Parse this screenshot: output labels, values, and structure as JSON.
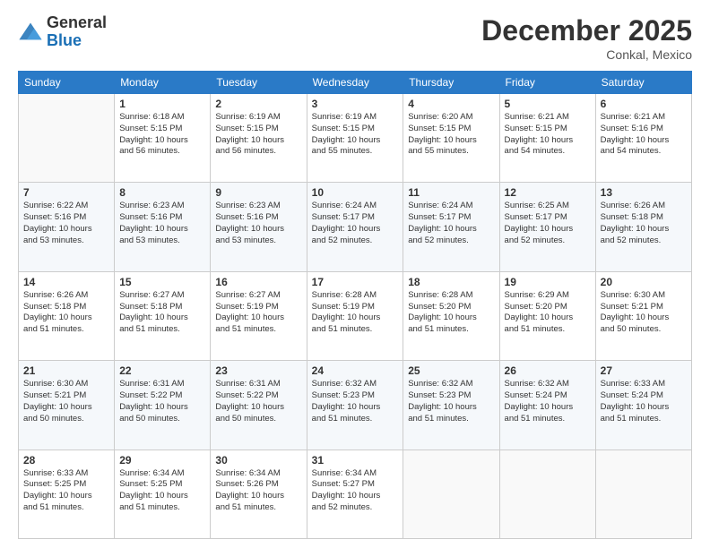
{
  "header": {
    "logo_general": "General",
    "logo_blue": "Blue",
    "month_title": "December 2025",
    "location": "Conkal, Mexico"
  },
  "days_of_week": [
    "Sunday",
    "Monday",
    "Tuesday",
    "Wednesday",
    "Thursday",
    "Friday",
    "Saturday"
  ],
  "weeks": [
    [
      {
        "day": "",
        "sunrise": "",
        "sunset": "",
        "daylight": ""
      },
      {
        "day": "1",
        "sunrise": "Sunrise: 6:18 AM",
        "sunset": "Sunset: 5:15 PM",
        "daylight": "Daylight: 10 hours and 56 minutes."
      },
      {
        "day": "2",
        "sunrise": "Sunrise: 6:19 AM",
        "sunset": "Sunset: 5:15 PM",
        "daylight": "Daylight: 10 hours and 56 minutes."
      },
      {
        "day": "3",
        "sunrise": "Sunrise: 6:19 AM",
        "sunset": "Sunset: 5:15 PM",
        "daylight": "Daylight: 10 hours and 55 minutes."
      },
      {
        "day": "4",
        "sunrise": "Sunrise: 6:20 AM",
        "sunset": "Sunset: 5:15 PM",
        "daylight": "Daylight: 10 hours and 55 minutes."
      },
      {
        "day": "5",
        "sunrise": "Sunrise: 6:21 AM",
        "sunset": "Sunset: 5:15 PM",
        "daylight": "Daylight: 10 hours and 54 minutes."
      },
      {
        "day": "6",
        "sunrise": "Sunrise: 6:21 AM",
        "sunset": "Sunset: 5:16 PM",
        "daylight": "Daylight: 10 hours and 54 minutes."
      }
    ],
    [
      {
        "day": "7",
        "sunrise": "Sunrise: 6:22 AM",
        "sunset": "Sunset: 5:16 PM",
        "daylight": "Daylight: 10 hours and 53 minutes."
      },
      {
        "day": "8",
        "sunrise": "Sunrise: 6:23 AM",
        "sunset": "Sunset: 5:16 PM",
        "daylight": "Daylight: 10 hours and 53 minutes."
      },
      {
        "day": "9",
        "sunrise": "Sunrise: 6:23 AM",
        "sunset": "Sunset: 5:16 PM",
        "daylight": "Daylight: 10 hours and 53 minutes."
      },
      {
        "day": "10",
        "sunrise": "Sunrise: 6:24 AM",
        "sunset": "Sunset: 5:17 PM",
        "daylight": "Daylight: 10 hours and 52 minutes."
      },
      {
        "day": "11",
        "sunrise": "Sunrise: 6:24 AM",
        "sunset": "Sunset: 5:17 PM",
        "daylight": "Daylight: 10 hours and 52 minutes."
      },
      {
        "day": "12",
        "sunrise": "Sunrise: 6:25 AM",
        "sunset": "Sunset: 5:17 PM",
        "daylight": "Daylight: 10 hours and 52 minutes."
      },
      {
        "day": "13",
        "sunrise": "Sunrise: 6:26 AM",
        "sunset": "Sunset: 5:18 PM",
        "daylight": "Daylight: 10 hours and 52 minutes."
      }
    ],
    [
      {
        "day": "14",
        "sunrise": "Sunrise: 6:26 AM",
        "sunset": "Sunset: 5:18 PM",
        "daylight": "Daylight: 10 hours and 51 minutes."
      },
      {
        "day": "15",
        "sunrise": "Sunrise: 6:27 AM",
        "sunset": "Sunset: 5:18 PM",
        "daylight": "Daylight: 10 hours and 51 minutes."
      },
      {
        "day": "16",
        "sunrise": "Sunrise: 6:27 AM",
        "sunset": "Sunset: 5:19 PM",
        "daylight": "Daylight: 10 hours and 51 minutes."
      },
      {
        "day": "17",
        "sunrise": "Sunrise: 6:28 AM",
        "sunset": "Sunset: 5:19 PM",
        "daylight": "Daylight: 10 hours and 51 minutes."
      },
      {
        "day": "18",
        "sunrise": "Sunrise: 6:28 AM",
        "sunset": "Sunset: 5:20 PM",
        "daylight": "Daylight: 10 hours and 51 minutes."
      },
      {
        "day": "19",
        "sunrise": "Sunrise: 6:29 AM",
        "sunset": "Sunset: 5:20 PM",
        "daylight": "Daylight: 10 hours and 51 minutes."
      },
      {
        "day": "20",
        "sunrise": "Sunrise: 6:30 AM",
        "sunset": "Sunset: 5:21 PM",
        "daylight": "Daylight: 10 hours and 50 minutes."
      }
    ],
    [
      {
        "day": "21",
        "sunrise": "Sunrise: 6:30 AM",
        "sunset": "Sunset: 5:21 PM",
        "daylight": "Daylight: 10 hours and 50 minutes."
      },
      {
        "day": "22",
        "sunrise": "Sunrise: 6:31 AM",
        "sunset": "Sunset: 5:22 PM",
        "daylight": "Daylight: 10 hours and 50 minutes."
      },
      {
        "day": "23",
        "sunrise": "Sunrise: 6:31 AM",
        "sunset": "Sunset: 5:22 PM",
        "daylight": "Daylight: 10 hours and 50 minutes."
      },
      {
        "day": "24",
        "sunrise": "Sunrise: 6:32 AM",
        "sunset": "Sunset: 5:23 PM",
        "daylight": "Daylight: 10 hours and 51 minutes."
      },
      {
        "day": "25",
        "sunrise": "Sunrise: 6:32 AM",
        "sunset": "Sunset: 5:23 PM",
        "daylight": "Daylight: 10 hours and 51 minutes."
      },
      {
        "day": "26",
        "sunrise": "Sunrise: 6:32 AM",
        "sunset": "Sunset: 5:24 PM",
        "daylight": "Daylight: 10 hours and 51 minutes."
      },
      {
        "day": "27",
        "sunrise": "Sunrise: 6:33 AM",
        "sunset": "Sunset: 5:24 PM",
        "daylight": "Daylight: 10 hours and 51 minutes."
      }
    ],
    [
      {
        "day": "28",
        "sunrise": "Sunrise: 6:33 AM",
        "sunset": "Sunset: 5:25 PM",
        "daylight": "Daylight: 10 hours and 51 minutes."
      },
      {
        "day": "29",
        "sunrise": "Sunrise: 6:34 AM",
        "sunset": "Sunset: 5:25 PM",
        "daylight": "Daylight: 10 hours and 51 minutes."
      },
      {
        "day": "30",
        "sunrise": "Sunrise: 6:34 AM",
        "sunset": "Sunset: 5:26 PM",
        "daylight": "Daylight: 10 hours and 51 minutes."
      },
      {
        "day": "31",
        "sunrise": "Sunrise: 6:34 AM",
        "sunset": "Sunset: 5:27 PM",
        "daylight": "Daylight: 10 hours and 52 minutes."
      },
      {
        "day": "",
        "sunrise": "",
        "sunset": "",
        "daylight": ""
      },
      {
        "day": "",
        "sunrise": "",
        "sunset": "",
        "daylight": ""
      },
      {
        "day": "",
        "sunrise": "",
        "sunset": "",
        "daylight": ""
      }
    ]
  ]
}
